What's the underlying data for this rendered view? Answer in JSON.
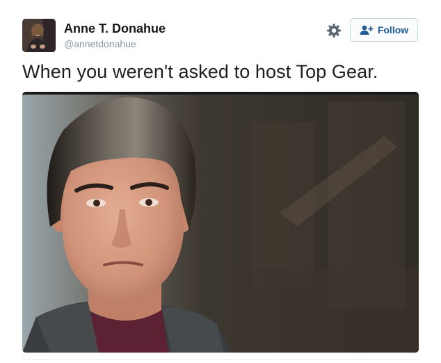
{
  "tweet": {
    "author_name": "Anne T. Donahue",
    "author_handle": "@annetdonahue",
    "text": "When you weren't asked to host Top Gear.",
    "follow_label": "Follow",
    "icons": {
      "settings": "gear-icon",
      "follow": "add-user-icon"
    },
    "colors": {
      "follow_text": "#1f5c96",
      "follow_border": "#c8d6e1",
      "handle": "#8899a6"
    }
  }
}
